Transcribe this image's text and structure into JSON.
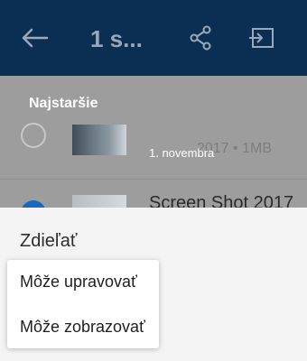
{
  "appbar": {
    "title": "1 s...",
    "back_icon": "back-arrow-icon",
    "share_icon": "share-icon",
    "move_icon": "move-to-icon"
  },
  "list": {
    "section_label": "Najstaršie",
    "date_label": "1. novembra",
    "item1_meta": "2017 • 1MB",
    "item2_name": "Screen Shot 2017"
  },
  "share_sheet": {
    "title": "Zdieľať",
    "options": [
      "Môže upravovať",
      "Môže zobrazovať"
    ]
  },
  "colors": {
    "appbar": "#0b2f52",
    "overlay": "#9d9d9d",
    "accent": "#1769c2"
  }
}
